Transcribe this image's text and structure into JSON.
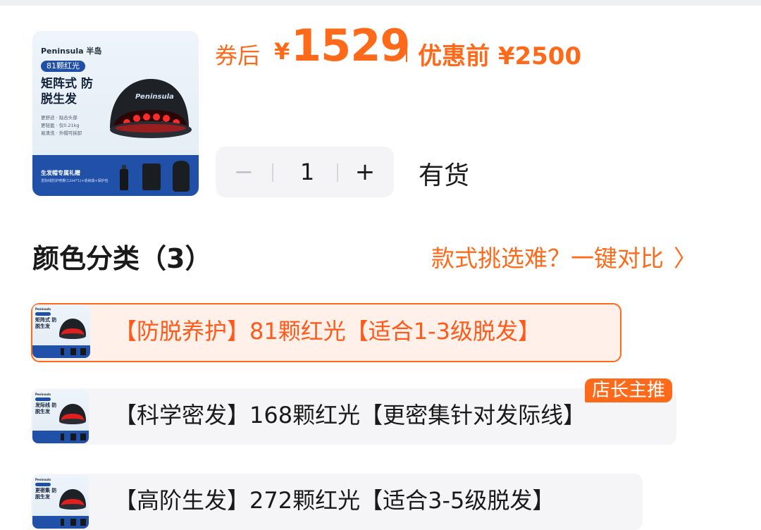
{
  "product": {
    "thumbnail": {
      "brand": "Peninsula 半岛",
      "pill": "81颗红光",
      "headline": "矩阵式 防脱生发",
      "specs": [
        "更舒适 · 贴合头部",
        "更轻盈 · 仅0.21kg",
        "易清洗 · 外帽可拆卸"
      ],
      "cap_text": "Peninsula",
      "gift_title": "生发帽专属礼赠",
      "gift_sub": "发际线防护喷雾(12ml*1)+收纳袋+保护包"
    }
  },
  "price": {
    "after_label": "券后",
    "currency": "¥",
    "amount": "1529",
    "before_text": "优惠前 ¥2500",
    "accent_color": "#ff6a1a"
  },
  "quantity": {
    "minus": "−",
    "value": "1",
    "plus": "+"
  },
  "stock_status": "有货",
  "section": {
    "title": "颜色分类（3）",
    "compare_link": "款式挑选难？一键对比",
    "chevron": "〉"
  },
  "options": [
    {
      "label": "【防脱养护】81颗红光【适合1-3级脱发】",
      "thumb_head": "矩阵式 防脱生发",
      "selected": true
    },
    {
      "label": "【科学密发】168颗红光【更密集针对发际线】",
      "thumb_head": "发际线 防脱生发",
      "selected": false,
      "badge": "店长主推"
    },
    {
      "label": "【高阶生发】272颗红光【适合3-5级脱发】",
      "thumb_head": "更密集 防脱生发",
      "selected": false
    }
  ]
}
